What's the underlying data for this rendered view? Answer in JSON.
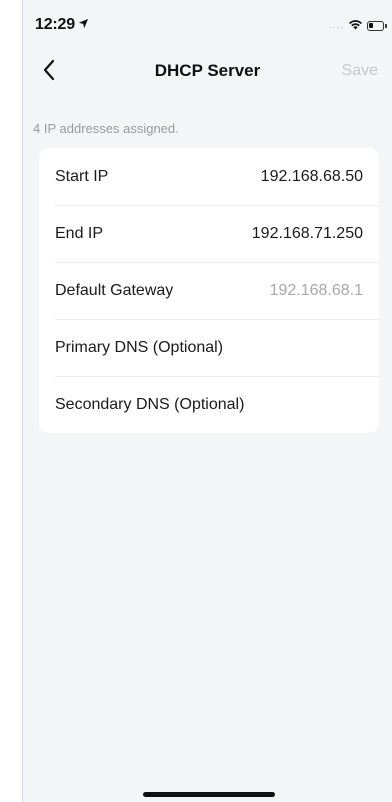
{
  "status_bar": {
    "time": "12:29",
    "location_icon": "location-arrow-icon",
    "signal_dots": "....",
    "wifi_icon": "wifi-icon",
    "battery_icon": "battery-icon",
    "battery_level": 0.35
  },
  "nav": {
    "back_icon": "chevron-left-icon",
    "title": "DHCP Server",
    "save_label": "Save"
  },
  "summary": {
    "assigned_text": "4 IP addresses assigned."
  },
  "fields": [
    {
      "label": "Start IP",
      "value": "192.168.68.50"
    },
    {
      "label": "End IP",
      "value": "192.168.71.250"
    },
    {
      "label": "Default Gateway",
      "value": "192.168.68.1"
    },
    {
      "label": "Primary DNS (Optional)",
      "value": ""
    },
    {
      "label": "Secondary DNS (Optional)",
      "value": ""
    }
  ],
  "colors": {
    "background": "#f4f5f7",
    "card": "#ffffff",
    "save_disabled": "#c8c8cc",
    "muted_text": "#9a9aa0"
  }
}
